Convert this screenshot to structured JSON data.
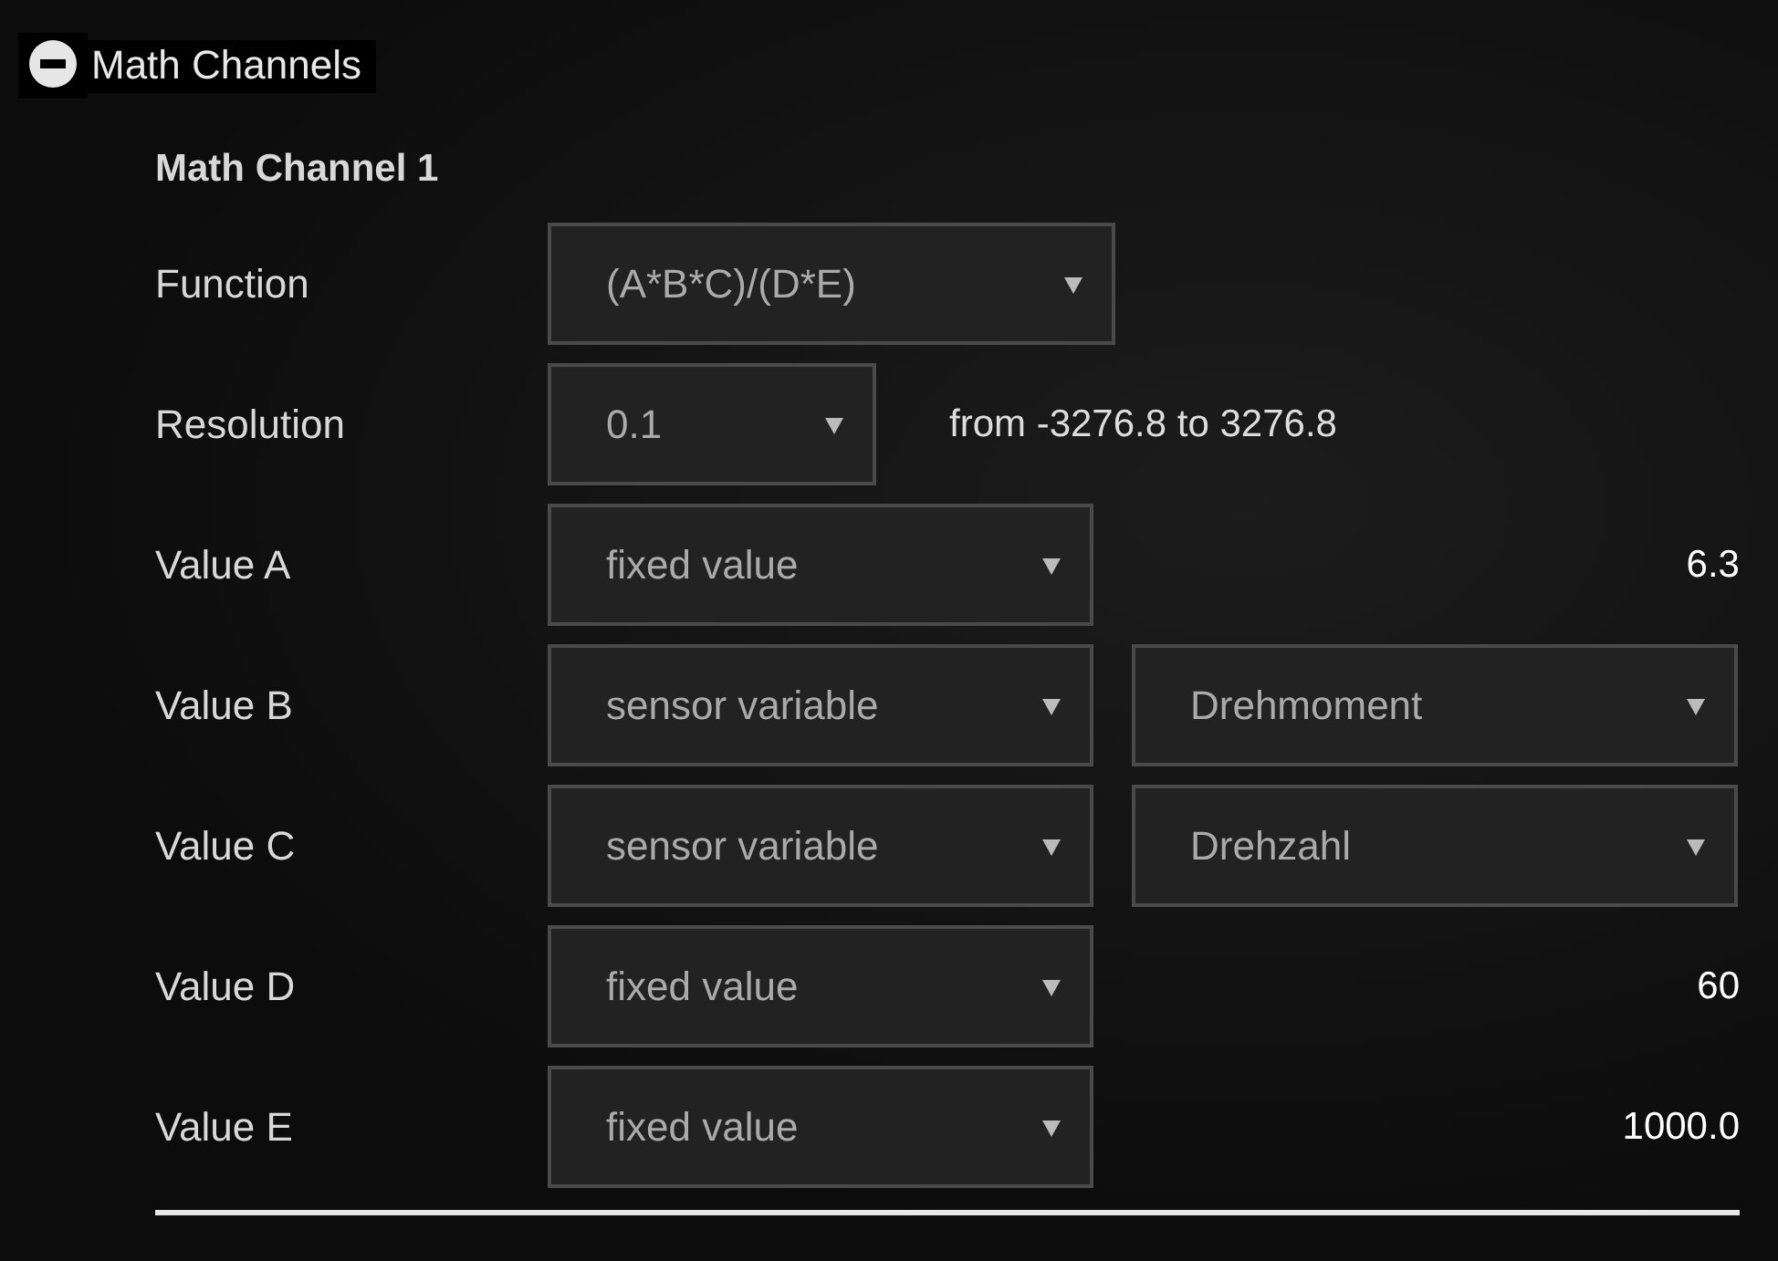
{
  "section": {
    "title": "Math Channels",
    "expanded": true
  },
  "channel": {
    "title": "Math Channel 1",
    "function": {
      "label": "Function",
      "value": "(A*B*C)/(D*E)"
    },
    "resolution": {
      "label": "Resolution",
      "value": "0.1",
      "range": "from -3276.8 to 3276.8"
    },
    "values": [
      {
        "label": "Value A",
        "kind": "fixed",
        "source": "fixed value",
        "value": "6.3"
      },
      {
        "label": "Value B",
        "kind": "sensor",
        "source": "sensor variable",
        "value": "Drehmoment"
      },
      {
        "label": "Value C",
        "kind": "sensor",
        "source": "sensor variable",
        "value": "Drehzahl"
      },
      {
        "label": "Value D",
        "kind": "fixed",
        "source": "fixed value",
        "value": "60"
      },
      {
        "label": "Value E",
        "kind": "fixed",
        "source": "fixed value",
        "value": "1000.0"
      }
    ]
  }
}
